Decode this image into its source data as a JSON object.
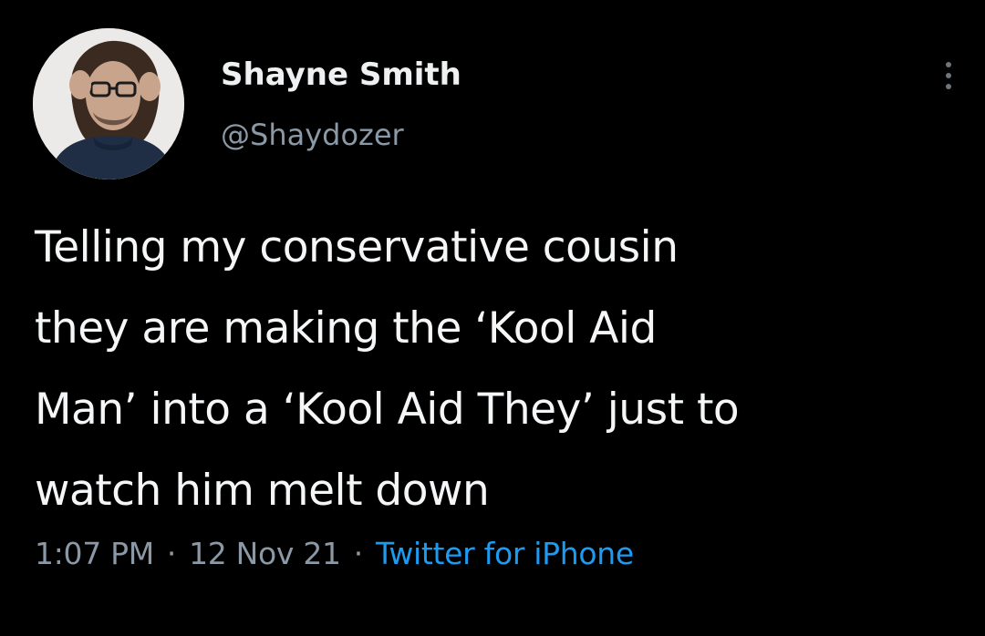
{
  "tweet": {
    "author": {
      "display_name": "Shayne Smith",
      "handle": "@Shaydozer",
      "avatar_icon": "profile-photo-avatar"
    },
    "more_icon": "more-options-vertical-dots-icon",
    "text": "Telling my conservative cousin\nthey are making the ‘Kool Aid\nMan’ into a ‘Kool Aid They’ just to\nwatch him melt down",
    "time": "1:07 PM",
    "date": "12 Nov 21",
    "separator": "·",
    "source": "Twitter for iPhone"
  },
  "colors": {
    "background": "#000000",
    "text": "#e7e9ea",
    "secondary": "#8b98a5",
    "link": "#1d9bf0"
  }
}
